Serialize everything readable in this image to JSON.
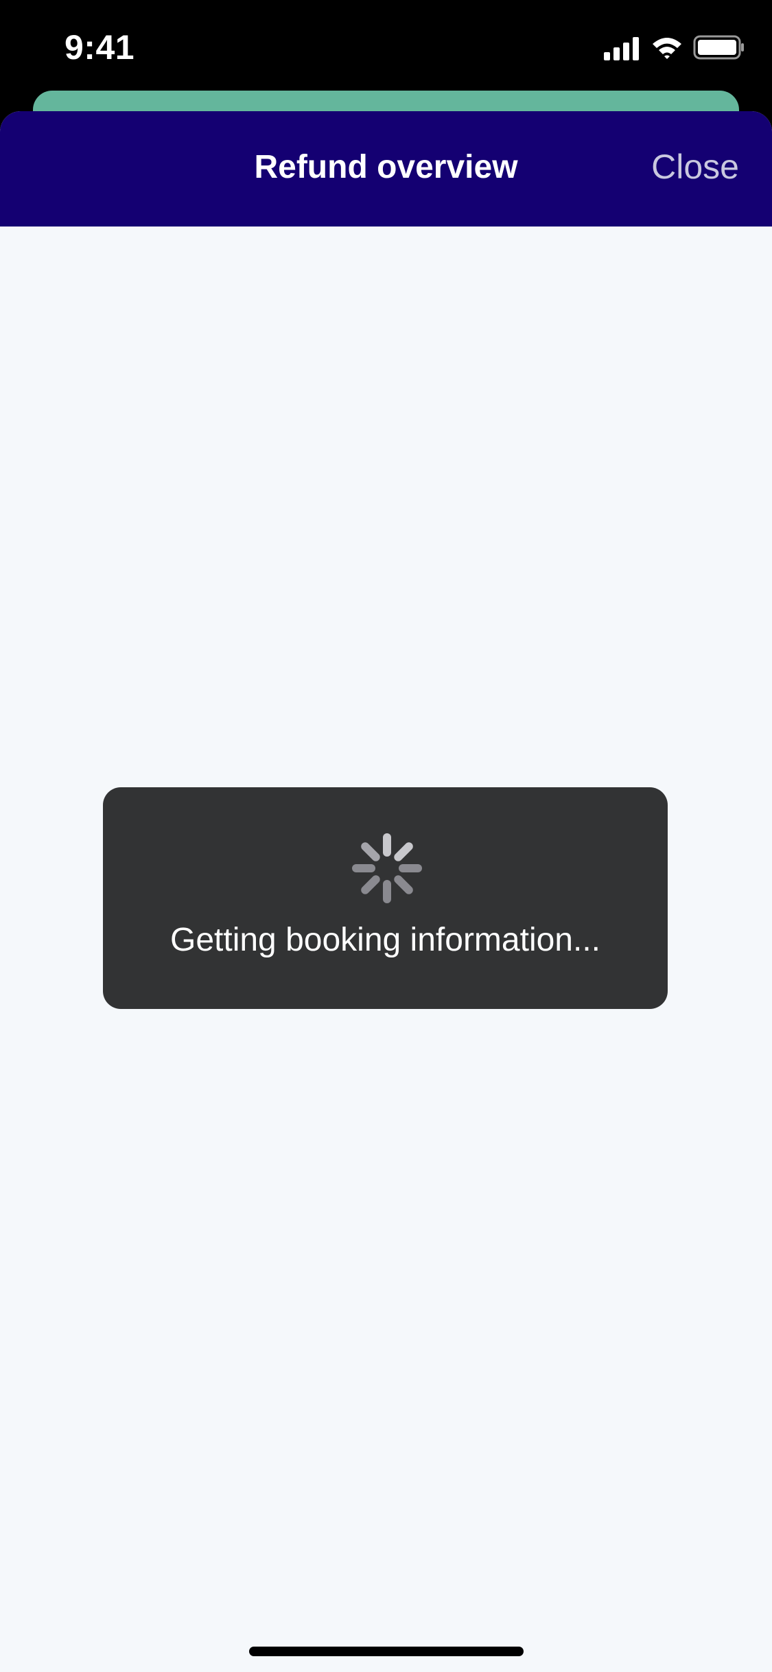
{
  "status_bar": {
    "time": "9:41"
  },
  "navigation": {
    "title": "Refund overview",
    "close_label": "Close"
  },
  "loading": {
    "message": "Getting booking information..."
  },
  "colors": {
    "nav_background": "#140072",
    "underlay_card": "#64b69c",
    "sheet_background": "#f5f8fb",
    "hud_background": "#323334",
    "close_text": "#c9c8df"
  },
  "icons": {
    "signal": "cellular-signal-icon",
    "wifi": "wifi-icon",
    "battery": "battery-icon",
    "spinner": "activity-spinner-icon"
  }
}
